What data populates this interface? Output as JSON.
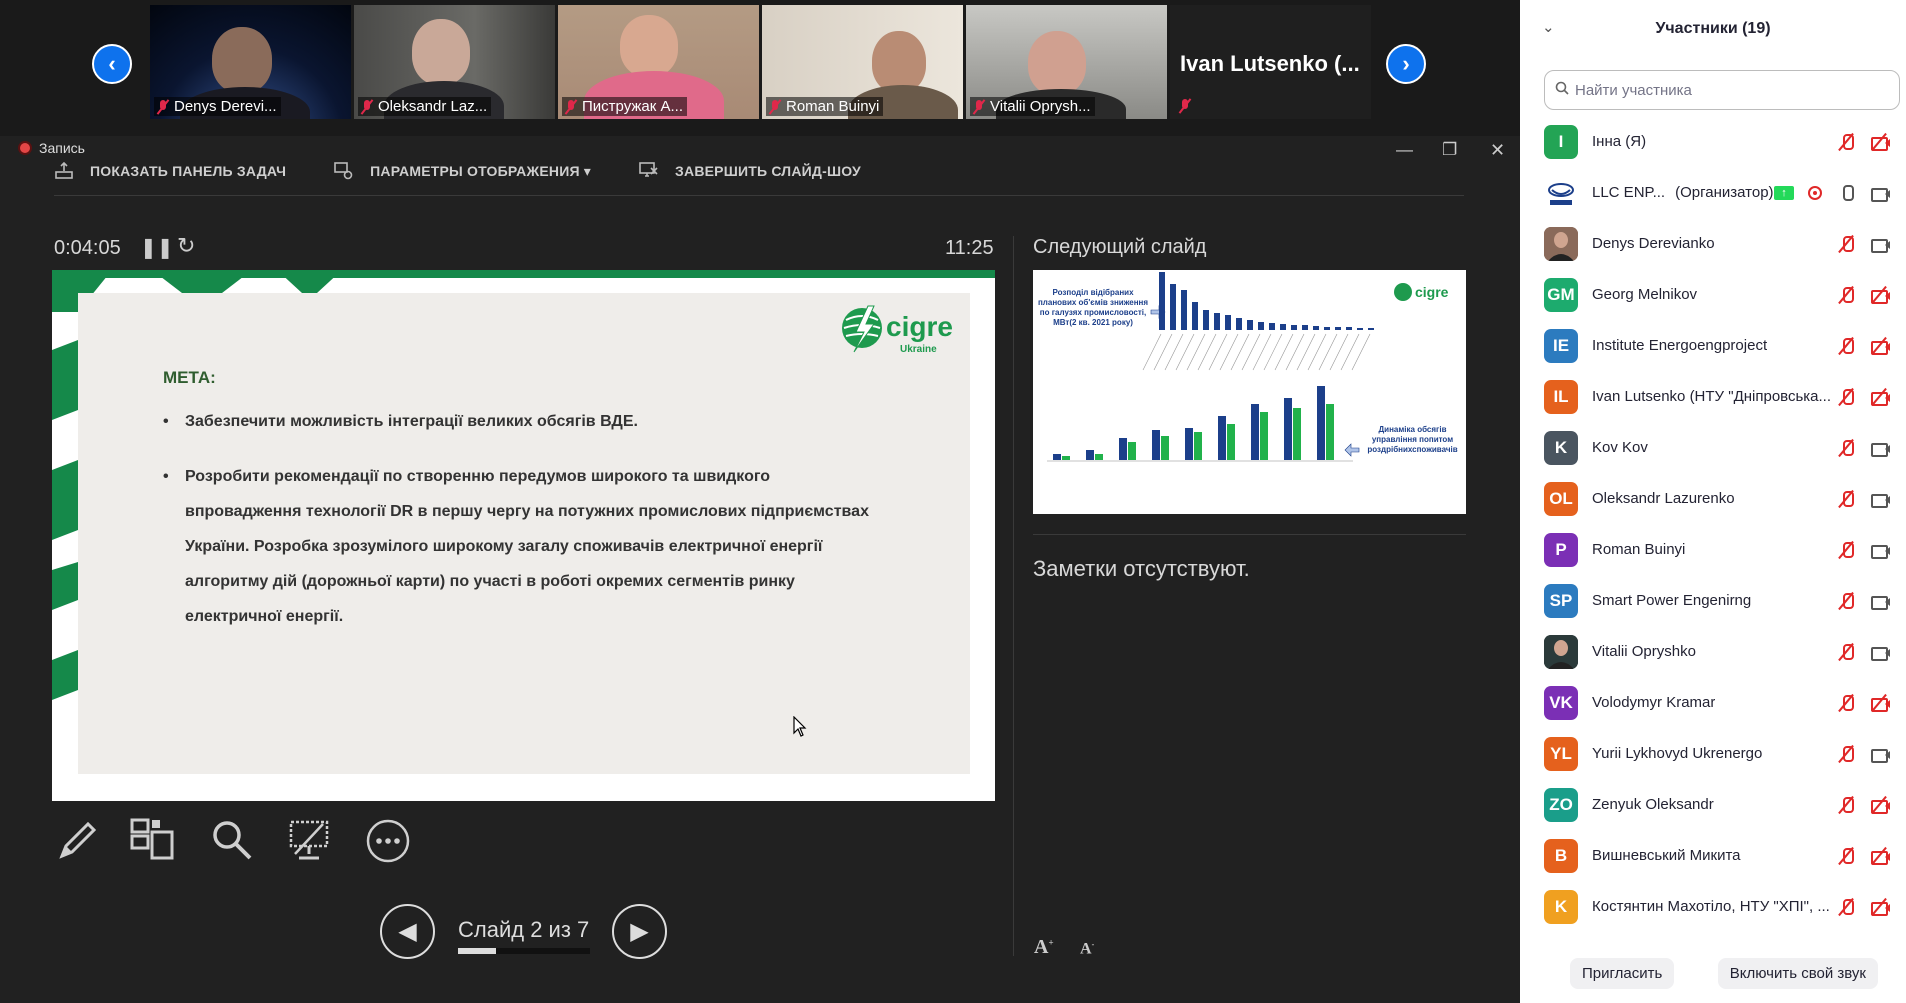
{
  "video_strip": {
    "tiles": [
      {
        "name": "Denys Derevi..."
      },
      {
        "name": "Oleksandr Laz..."
      },
      {
        "name": "Пистружак А..."
      },
      {
        "name": "Roman Buinyi"
      },
      {
        "name": "Vitalii Oprysh..."
      }
    ],
    "text_tile_name": "Ivan Lutsenko (..."
  },
  "recording": {
    "label": "Запись"
  },
  "toolbar": {
    "show_taskbar": "ПОКАЗАТЬ ПАНЕЛЬ ЗАДАЧ",
    "display_settings": "ПАРАМЕТРЫ ОТОБРАЖЕНИЯ ▾",
    "end_show": "ЗАВЕРШИТЬ СЛАЙД-ШОУ"
  },
  "presenter": {
    "timer": "0:04:05",
    "clock": "11:25",
    "next_slide_label": "Следующий слайд",
    "notes": "Заметки отсутствуют.",
    "slide_counter": "Слайд 2 из 7",
    "progress": 0.2857
  },
  "slide": {
    "logo_text": "cigre",
    "logo_sub": "Ukraine",
    "heading": "МЕТА:",
    "bullets": [
      "Забезпечити можливість інтеграції великих обсягів ВДЕ.",
      "Розробити рекомендації по створенню передумов широкого та швидкого впровадження технології DR в першу чергу на потужних промислових підприємствах України. Розробка зрозумілого широкому загалу споживачів електричної енергії алгоритму дій (дорожньої карти) по участі в роботі окремих сегментів ринку електричної енергії."
    ]
  },
  "next_slide": {
    "logo_text": "cigre",
    "top_caption": "Розподіл відібраних планових об'ємів зниження по галузях промисловості, МВт(2 кв. 2021 року)",
    "bottom_caption": "Динаміка обсягів управління попитом роздрібнихспоживачів"
  },
  "participants": {
    "title": "Участники (19)",
    "search_placeholder": "Найти участника",
    "invite": "Пригласить",
    "unmute": "Включить свой звук",
    "list": [
      {
        "initials": "I",
        "name": "Інна (Я)",
        "color": "#23a455",
        "mic": "off",
        "cam": "off"
      },
      {
        "initials": "",
        "name": "LLC ENP...",
        "role": "(Организатор)",
        "color": "#ffffff",
        "mic": "on",
        "cam": "on",
        "host": true
      },
      {
        "initials": "",
        "name": "Denys Derevianko",
        "color": "#8a6a5a",
        "mic": "off",
        "cam": "on",
        "photo": true
      },
      {
        "initials": "GM",
        "name": "Georg Melnikov",
        "color": "#1dab6e",
        "mic": "off",
        "cam": "off"
      },
      {
        "initials": "IE",
        "name": "Institute Energoengproject",
        "color": "#2c7bbf",
        "mic": "off",
        "cam": "off"
      },
      {
        "initials": "IL",
        "name": "Ivan Lutsenko (НТУ \"Дніпровська...",
        "color": "#e5611d",
        "mic": "off",
        "cam": "off"
      },
      {
        "initials": "K",
        "name": "Kov Kov",
        "color": "#4a5560",
        "mic": "off",
        "cam": "on"
      },
      {
        "initials": "OL",
        "name": "Oleksandr Lazurenko",
        "color": "#e5611d",
        "mic": "off",
        "cam": "on"
      },
      {
        "initials": "P",
        "name": "Roman Buinyi",
        "color": "#7b2fb5",
        "mic": "off",
        "cam": "on"
      },
      {
        "initials": "SP",
        "name": "Smart Power Engenirng",
        "color": "#2c7bbf",
        "mic": "off",
        "cam": "on"
      },
      {
        "initials": "",
        "name": "Vitalii Opryshko",
        "color": "#2b3a3a",
        "mic": "off",
        "cam": "on",
        "photo": true
      },
      {
        "initials": "VK",
        "name": "Volodymyr Kramar",
        "color": "#7b2fb5",
        "mic": "off",
        "cam": "off"
      },
      {
        "initials": "YL",
        "name": "Yurii Lykhovyd Ukrenergo",
        "color": "#e5611d",
        "mic": "off",
        "cam": "on"
      },
      {
        "initials": "ZO",
        "name": "Zenyuk Oleksandr",
        "color": "#1a9e8a",
        "mic": "off",
        "cam": "off"
      },
      {
        "initials": "B",
        "name": "Вишневський Микита",
        "color": "#e5611d",
        "mic": "off",
        "cam": "off"
      },
      {
        "initials": "K",
        "name": "Костянтин Махотіло, НТУ \"ХПІ\", ...",
        "color": "#f0a020",
        "mic": "off",
        "cam": "off"
      }
    ]
  }
}
